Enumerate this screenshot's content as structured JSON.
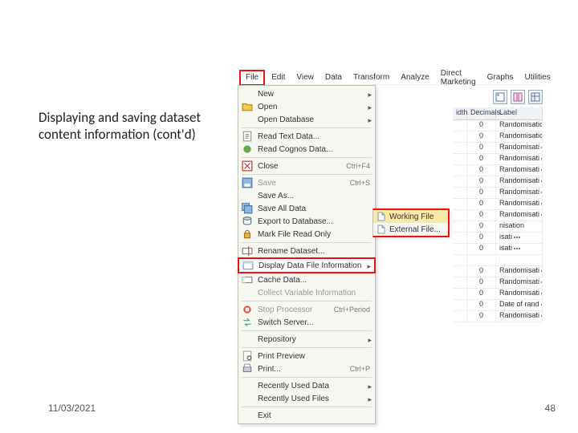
{
  "slide": {
    "title": "Displaying and saving dataset content information (cont'd)",
    "date": "11/03/2021",
    "page": "48"
  },
  "menubar": [
    "File",
    "Edit",
    "View",
    "Data",
    "Transform",
    "Analyze",
    "Direct Marketing",
    "Graphs",
    "Utilities"
  ],
  "menu_highlight_index": 0,
  "dropdown": [
    {
      "label": "New",
      "arrow": true,
      "icon": "blank"
    },
    {
      "label": "Open",
      "arrow": true,
      "icon": "open"
    },
    {
      "label": "Open Database",
      "arrow": true,
      "icon": "blank"
    },
    {
      "sep": true
    },
    {
      "label": "Read Text Data...",
      "icon": "text"
    },
    {
      "label": "Read Cognos Data...",
      "icon": "cognos"
    },
    {
      "sep": true
    },
    {
      "label": "Close",
      "acc": "Ctrl+F4",
      "icon": "close"
    },
    {
      "sep": true
    },
    {
      "label": "Save",
      "acc": "Ctrl+S",
      "icon": "save",
      "disabled": true
    },
    {
      "label": "Save As...",
      "icon": "blank"
    },
    {
      "label": "Save All Data",
      "icon": "saveall"
    },
    {
      "label": "Export to Database...",
      "icon": "export"
    },
    {
      "label": "Mark File Read Only",
      "icon": "lock"
    },
    {
      "sep": true
    },
    {
      "label": "Rename Dataset...",
      "icon": "rename"
    },
    {
      "label": "Display Data File Information",
      "arrow": true,
      "icon": "info",
      "highlight": true
    },
    {
      "label": "Cache Data...",
      "icon": "cache"
    },
    {
      "label": "Collect Variable Information",
      "icon": "blank",
      "disabled": true
    },
    {
      "sep": true
    },
    {
      "label": "Stop Processor",
      "acc": "Ctrl+Period",
      "icon": "stop",
      "disabled": true
    },
    {
      "label": "Switch Server...",
      "icon": "switch"
    },
    {
      "sep": true
    },
    {
      "label": "Repository",
      "arrow": true,
      "icon": "blank"
    },
    {
      "sep": true
    },
    {
      "label": "Print Preview",
      "icon": "preview"
    },
    {
      "label": "Print...",
      "acc": "Ctrl+P",
      "icon": "print"
    },
    {
      "sep": true
    },
    {
      "label": "Recently Used Data",
      "arrow": true,
      "icon": "blank"
    },
    {
      "label": "Recently Used Files",
      "arrow": true,
      "icon": "blank"
    },
    {
      "sep": true
    },
    {
      "label": "Exit",
      "icon": "blank"
    }
  ],
  "submenu": [
    {
      "label": "Working File",
      "icon": "file",
      "selected": true
    },
    {
      "label": "External File...",
      "icon": "file"
    }
  ],
  "grid": {
    "headers": {
      "width": "idth",
      "decimals": "Decimals",
      "label": "Label"
    },
    "rows": [
      {
        "d": "0",
        "lb": "Randomisation…"
      },
      {
        "d": "0",
        "lb": "Randomisation"
      },
      {
        "d": "0",
        "lb": "Randomisati…"
      },
      {
        "d": "0",
        "lb": "Randomisati…"
      },
      {
        "d": "0",
        "lb": "Randomisati…"
      },
      {
        "d": "0",
        "lb": "Randomisati…"
      },
      {
        "d": "0",
        "lb": "Randomisati…"
      },
      {
        "d": "0",
        "lb": "Randomisati…"
      },
      {
        "d": "0",
        "lb": "Randomisati…"
      },
      {
        "d": "0",
        "lb": "nisation"
      },
      {
        "d": "0",
        "lb": "isati…"
      },
      {
        "d": "0",
        "lb": "isati…"
      },
      {
        "d": "",
        "lb": ""
      },
      {
        "d": "0",
        "lb": "Randomisati…"
      },
      {
        "d": "0",
        "lb": "Randomisati…"
      },
      {
        "d": "0",
        "lb": "Randomisati…"
      },
      {
        "d": "0",
        "lb": "Date of rand…"
      },
      {
        "d": "0",
        "lb": "Randomisati…"
      }
    ]
  },
  "icons": {
    "open": "folder-icon",
    "text": "text-file-icon",
    "cognos": "cognos-icon",
    "close": "close-icon",
    "save": "save-icon",
    "saveall": "save-all-icon",
    "export": "database-export-icon",
    "lock": "lock-icon",
    "rename": "rename-icon",
    "info": "info-icon",
    "cache": "cache-icon",
    "stop": "stop-icon",
    "switch": "switch-server-icon",
    "preview": "print-preview-icon",
    "print": "print-icon",
    "file": "file-icon",
    "blank": "blank-icon"
  }
}
